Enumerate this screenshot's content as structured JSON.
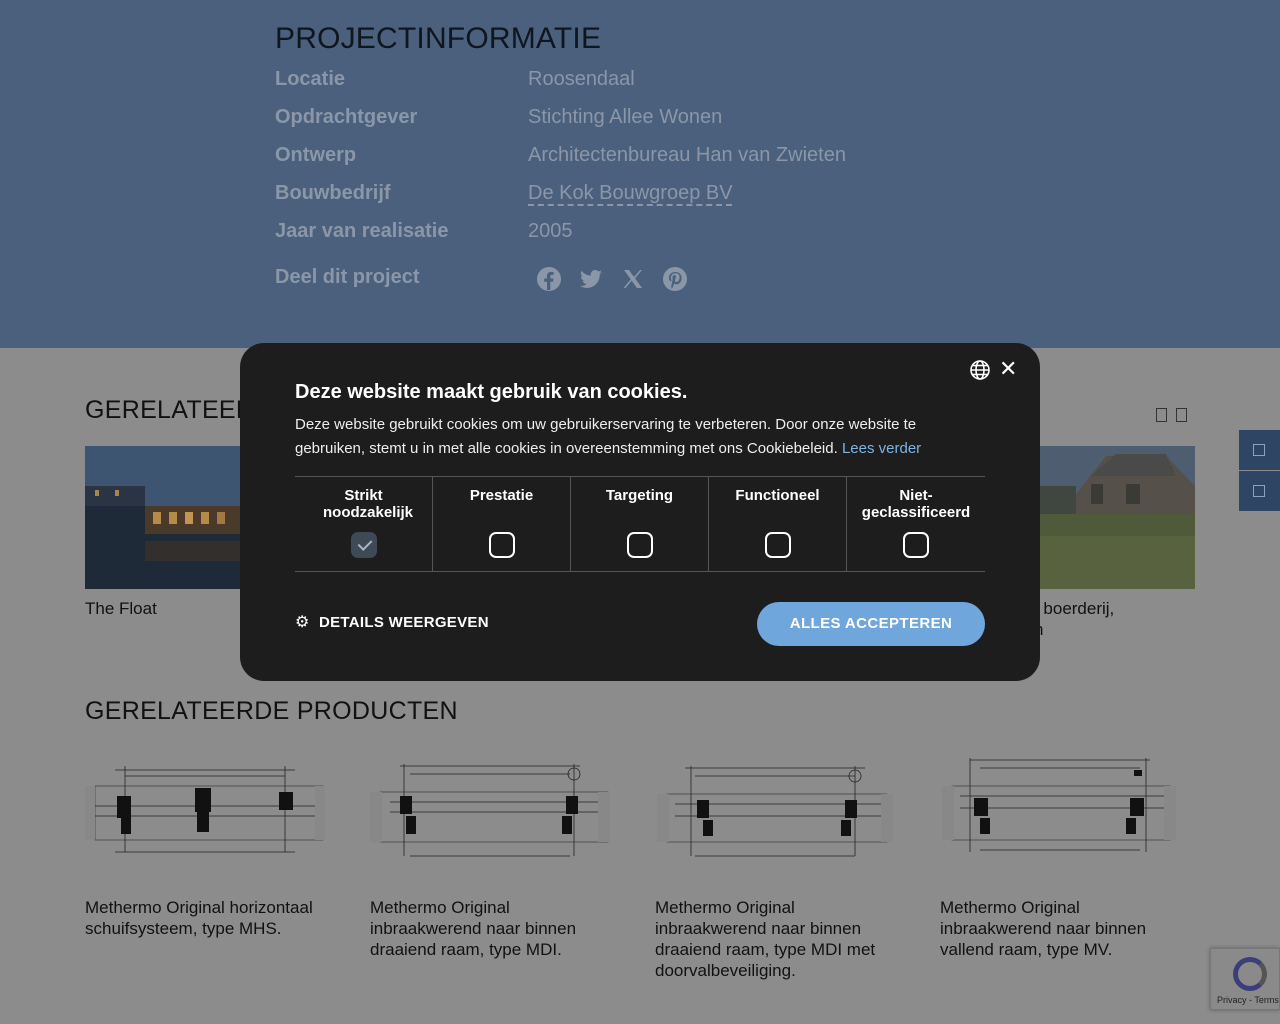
{
  "project_info": {
    "title": "PROJECTINFORMATIE",
    "rows": [
      {
        "key": "Locatie",
        "value": "Roosendaal"
      },
      {
        "key": "Opdrachtgever",
        "value": "Stichting Allee Wonen"
      },
      {
        "key": "Ontwerp",
        "value": "Architectenbureau Han van Zwieten"
      },
      {
        "key": "Bouwbedrijf",
        "value": "De Kok Bouwgroep BV"
      },
      {
        "key": "Jaar van realisatie",
        "value": "2005"
      }
    ],
    "share_label": "Deel dit project",
    "share_icons": [
      "facebook-icon",
      "twitter-icon",
      "x-icon",
      "pinterest-icon"
    ]
  },
  "related_projects": {
    "title": "GERELATEERDE PROJECTEN",
    "title_visible": "GERELATEER",
    "items": [
      {
        "caption": "The Float"
      },
      {
        "caption": "ing boerderij,\nven"
      }
    ]
  },
  "related_products": {
    "title": "GERELATEERDE PRODUCTEN",
    "items": [
      {
        "caption": "Methermo Original horizontaal schuifsysteem, type MHS."
      },
      {
        "caption": "Methermo Original inbraakwerend naar binnen draaiend raam, type MDI."
      },
      {
        "caption": "Methermo Original inbraakwerend naar binnen draaiend raam, type MDI met doorvalbeveiliging."
      },
      {
        "caption": "Methermo Original inbraakwerend naar binnen vallend raam, type MV."
      }
    ]
  },
  "cookie_modal": {
    "title": "Deze website maakt gebruik van cookies.",
    "description": "Deze website gebruikt cookies om uw gebruikerservaring te verbeteren. Door onze website te gebruiken, stemt u in met alle cookies in overeenstemming met ons Cookiebeleid.",
    "read_more": "Lees verder",
    "categories": [
      {
        "label": "Strikt noodzakelijk",
        "checked": true
      },
      {
        "label": "Prestatie",
        "checked": false
      },
      {
        "label": "Targeting",
        "checked": false
      },
      {
        "label": "Functioneel",
        "checked": false
      },
      {
        "label": "Niet-geclassificeerd",
        "checked": false
      }
    ],
    "details_label": "DETAILS WEERGEVEN",
    "accept_label": "ALLES ACCEPTEREN"
  },
  "recaptcha": {
    "terms": "Privacy - Terms"
  },
  "colors": {
    "info_bg": "#4a607c",
    "modal_bg": "#1d1d1d",
    "accept_button": "#6fa6dc",
    "link": "#7fb3e4"
  }
}
